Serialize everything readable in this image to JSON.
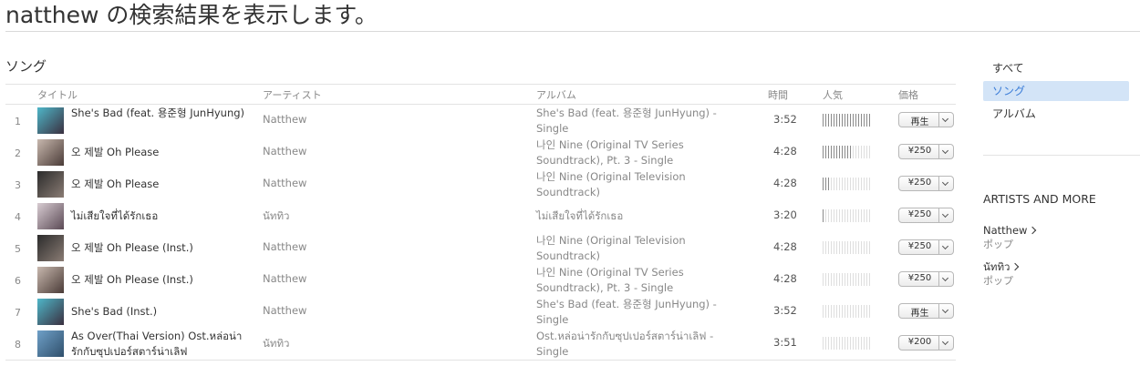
{
  "page": {
    "title": "natthew の検索結果を表示します。"
  },
  "songs_section": {
    "heading": "ソング",
    "columns": {
      "title": "タイトル",
      "artist": "アーティスト",
      "album": "アルバム",
      "time": "時間",
      "popularity": "人気",
      "price": "価格"
    },
    "rows": [
      {
        "num": "1",
        "title": "She's Bad (feat. 용준형 JunHyung)",
        "artist": "Natthew",
        "album": "She's Bad (feat. 용준형 JunHyung) - Single",
        "time": "3:52",
        "popularity": 1.0,
        "price": "再生",
        "art_colors": [
          "#4fb7c9",
          "#3a2f3f"
        ]
      },
      {
        "num": "2",
        "title": "오 제발 Oh Please",
        "artist": "Natthew",
        "album": "나인 Nine (Original TV Series Soundtrack), Pt. 3 - Single",
        "time": "4:28",
        "popularity": 0.6,
        "price": "¥250",
        "art_colors": [
          "#c8b8ae",
          "#4a3b37"
        ]
      },
      {
        "num": "3",
        "title": "오 제발 Oh Please",
        "artist": "Natthew",
        "album": "나인 Nine (Original Television Soundtrack)",
        "time": "4:28",
        "popularity": 0.15,
        "price": "¥250",
        "art_colors": [
          "#2b2b2b",
          "#8a7c74"
        ]
      },
      {
        "num": "4",
        "title": "ไม่เสียใจที่ได้รักเธอ",
        "artist": "นัททิว",
        "album": "ไม่เสียใจที่ได้รักเธอ",
        "time": "3:20",
        "popularity": 0.05,
        "price": "¥250",
        "art_colors": [
          "#d8ccd2",
          "#5b4a55"
        ]
      },
      {
        "num": "5",
        "title": "오 제발 Oh Please (Inst.)",
        "artist": "Natthew",
        "album": "나인 Nine (Original Television Soundtrack)",
        "time": "4:28",
        "popularity": 0.0,
        "price": "¥250",
        "art_colors": [
          "#2b2b2b",
          "#8a7c74"
        ]
      },
      {
        "num": "6",
        "title": "오 제발 Oh Please (Inst.)",
        "artist": "Natthew",
        "album": "나인 Nine (Original TV Series Soundtrack), Pt. 3 - Single",
        "time": "4:28",
        "popularity": 0.0,
        "price": "¥250",
        "art_colors": [
          "#c8b8ae",
          "#4a3b37"
        ]
      },
      {
        "num": "7",
        "title": "She's Bad (Inst.)",
        "artist": "Natthew",
        "album": "She's Bad (feat. 용준형 JunHyung) - Single",
        "time": "3:52",
        "popularity": 0.0,
        "price": "再生",
        "art_colors": [
          "#4fb7c9",
          "#3a2f3f"
        ]
      },
      {
        "num": "8",
        "title": "As Over(Thai Version) Ost.หล่อน่ารักกับซุปเปอร์สตาร์น่าเลิฟ",
        "artist": "นัททิว",
        "album": "Ost.หล่อน่ารักกับซุปเปอร์สตาร์น่าเลิฟ - Single",
        "time": "3:51",
        "popularity": 0.0,
        "price": "¥200",
        "art_colors": [
          "#6fa0c8",
          "#2f4f6b"
        ]
      }
    ]
  },
  "filters": {
    "items": [
      {
        "label": "すべて",
        "active": false
      },
      {
        "label": "ソング",
        "active": true
      },
      {
        "label": "アルバム",
        "active": false
      }
    ]
  },
  "artists_more": {
    "heading": "ARTISTS AND MORE",
    "items": [
      {
        "name": "Natthew",
        "genre": "ポップ"
      },
      {
        "name": "นัททิว",
        "genre": "ポップ"
      }
    ]
  }
}
